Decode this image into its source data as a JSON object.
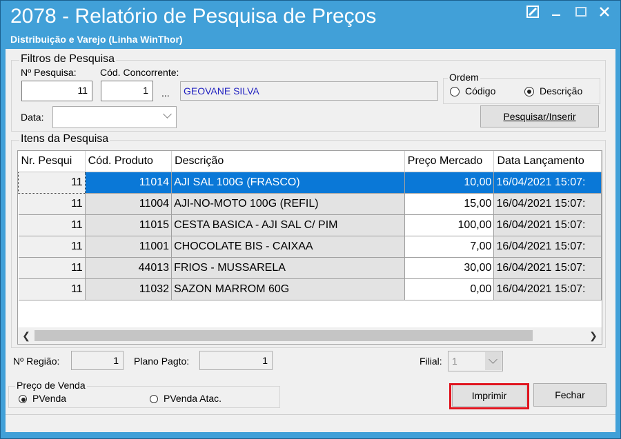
{
  "window": {
    "title": "2078 - Relatório de Pesquisa de Preços",
    "subtitle": "Distribuição e Varejo (Linha WinThor)"
  },
  "filters": {
    "legend": "Filtros de Pesquisa",
    "num_label": "Nº Pesquisa:",
    "num_value": "11",
    "comp_label": "Cód. Concorrente:",
    "comp_value": "1",
    "ellipsis": "...",
    "comp_name": "GEOVANE SILVA",
    "date_label": "Data:",
    "order": {
      "legend": "Ordem",
      "code_label": "Código",
      "desc_label": "Descrição",
      "selected": "Descrição"
    },
    "search_button": "Pesquisar/Inserir"
  },
  "items": {
    "legend": "Itens da Pesquisa",
    "headers": [
      "Nr. Pesqui",
      "Cód. Produto",
      "Descrição",
      "Preço Mercado",
      "Data Lançamento"
    ],
    "rows": [
      [
        "11",
        "11014",
        "AJI SAL 100G (FRASCO)",
        "10,00",
        "16/04/2021 15:07:"
      ],
      [
        "11",
        "11004",
        "AJI-NO-MOTO 100G (REFIL)",
        "15,00",
        "16/04/2021 15:07:"
      ],
      [
        "11",
        "11015",
        "CESTA BASICA - AJI SAL C/ PIM",
        "100,00",
        "16/04/2021 15:07:"
      ],
      [
        "11",
        "11001",
        "CHOCOLATE BIS  - CAIXAA",
        "7,00",
        "16/04/2021 15:07:"
      ],
      [
        "11",
        "44013",
        "FRIOS - MUSSARELA",
        "30,00",
        "16/04/2021 15:07:"
      ],
      [
        "11",
        "11032",
        "SAZON MARROM 60G",
        "0,00",
        "16/04/2021 15:07:"
      ]
    ],
    "selected_row": 0
  },
  "footer_fields": {
    "region_label": "Nº Região:",
    "region_value": "1",
    "plan_label": "Plano Pagto:",
    "plan_value": "1",
    "branch_label": "Filial:",
    "branch_value": "1"
  },
  "price": {
    "legend": "Preço de Venda",
    "opt1": "PVenda",
    "opt2": "PVenda Atac.",
    "selected": "PVenda"
  },
  "buttons": {
    "print": "Imprimir",
    "close": "Fechar"
  },
  "colors": {
    "titlebar": "#41a0d8",
    "selection": "#0a78d7",
    "highlight_box": "#e0141e",
    "comp_name_text": "#2020c0"
  }
}
